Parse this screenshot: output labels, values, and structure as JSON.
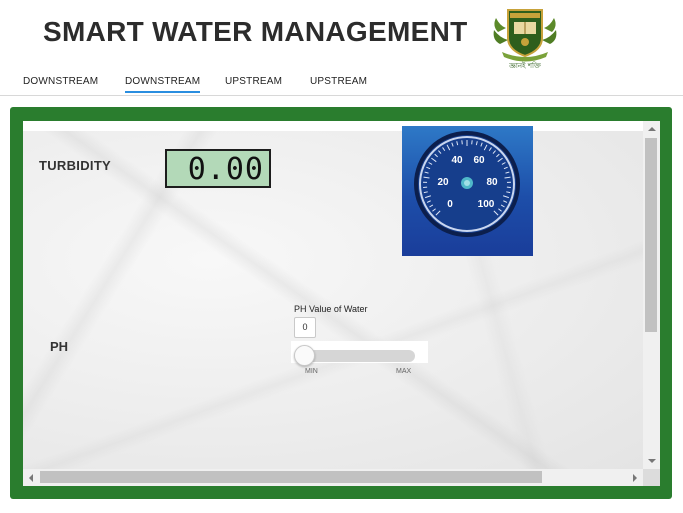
{
  "header": {
    "title": "SMART WATER MANAGEMENT",
    "logo_icon": "university-crest-icon",
    "logo_caption": "জ্ঞানই শক্তি"
  },
  "tabs": [
    {
      "label": "DOWNSTREAM",
      "active": false
    },
    {
      "label": "DOWNSTREAM",
      "active": true
    },
    {
      "label": "UPSTREAM",
      "active": false
    },
    {
      "label": "UPSTREAM",
      "active": false
    }
  ],
  "dashboard": {
    "turbidity": {
      "label": "TURBIDITY",
      "value": "0.00"
    },
    "gauge": {
      "ticks": [
        "0",
        "20",
        "40",
        "60",
        "80",
        "100"
      ],
      "value": 0
    },
    "ph": {
      "label": "PH",
      "slider_title": "PH Value of Water",
      "value": "0",
      "min_label": "MIN",
      "max_label": "MAX"
    }
  },
  "colors": {
    "frame": "#2a7d2e",
    "tab_active_underline": "#2a8ee0",
    "lcd": "#b3d9b8",
    "gauge_face": "#1d4ea9"
  }
}
